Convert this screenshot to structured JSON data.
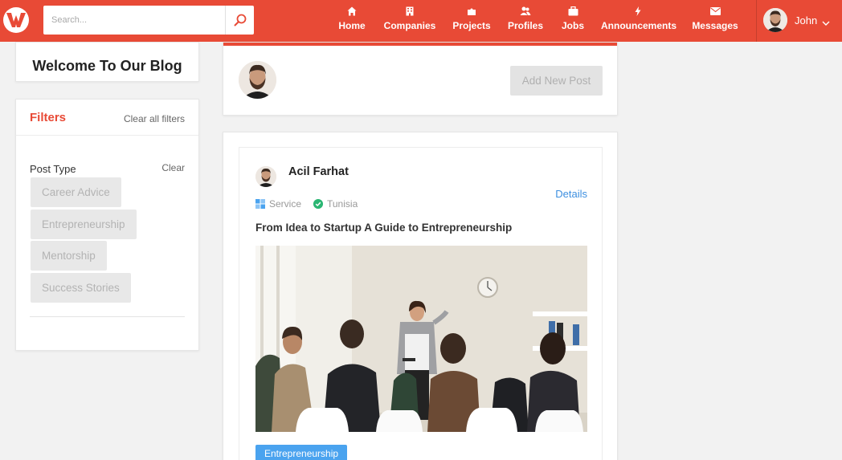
{
  "search": {
    "placeholder": "Search..."
  },
  "nav": [
    {
      "label": "Home",
      "icon": "home-icon"
    },
    {
      "label": "Companies",
      "icon": "building-icon"
    },
    {
      "label": "Projects",
      "icon": "puzzle-icon"
    },
    {
      "label": "Profiles",
      "icon": "users-icon"
    },
    {
      "label": "Jobs",
      "icon": "briefcase-icon"
    },
    {
      "label": "Announcements",
      "icon": "bolt-icon"
    },
    {
      "label": "Messages",
      "icon": "envelope-icon"
    }
  ],
  "user": {
    "name": "John"
  },
  "sidebar": {
    "welcome": "Welcome To Our Blog",
    "filters_title": "Filters",
    "clear_all": "Clear all filters",
    "post_type_label": "Post Type",
    "post_type_clear": "Clear",
    "post_types": [
      "Career Advice",
      "Entrepreneurship",
      "Mentorship",
      "Success Stories"
    ]
  },
  "new_post": {
    "button": "Add New Post"
  },
  "post": {
    "author": "Acil Farhat",
    "details": "Details",
    "category": "Service",
    "location": "Tunisia",
    "title": "From Idea to Startup A Guide to Entrepreneurship",
    "tag": "Entrepreneurship"
  },
  "colors": {
    "brand": "#e84a36",
    "link": "#3d8fe0",
    "tag": "#4aa3ef",
    "verified": "#2bb673"
  }
}
